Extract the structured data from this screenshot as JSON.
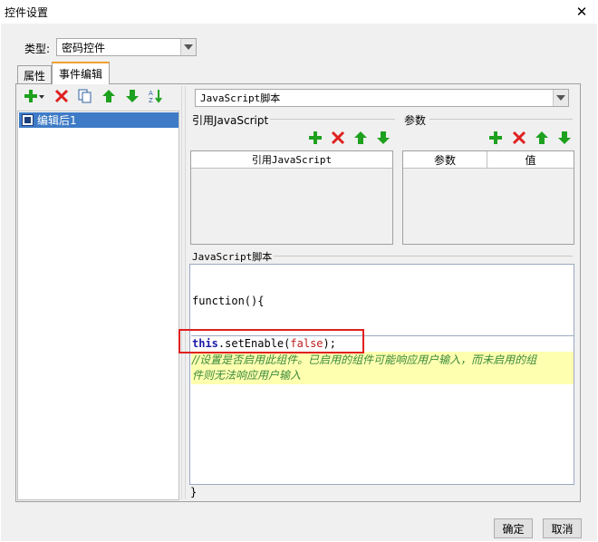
{
  "window": {
    "title": "控件设置"
  },
  "type_field": {
    "label": "类型:",
    "value": "密码控件"
  },
  "tabs": [
    {
      "label": "属性"
    },
    {
      "label": "事件编辑"
    }
  ],
  "event_list": {
    "items": [
      {
        "label": "编辑后1"
      }
    ]
  },
  "script_type": {
    "value": "JavaScript脚本"
  },
  "ref_js": {
    "label": "引用JavaScript",
    "column": "引用JavaScript"
  },
  "params": {
    "label": "参数",
    "col_param": "参数",
    "col_value": "值"
  },
  "js_script": {
    "label": "JavaScript脚本",
    "header": "function(){",
    "code_keyword": "this",
    "code_method": ".setEnable(",
    "code_arg": "false",
    "code_close": ");",
    "comment_line1": "//设置是否启用此组件。已启用的组件可能响应用户输入，而未启用的组",
    "comment_line2": "件则无法响应用户输入",
    "footer": "}"
  },
  "buttons": {
    "ok": "确定",
    "cancel": "取消"
  },
  "icons": {
    "add": "plus-icon",
    "delete": "x-icon",
    "copy": "copy-icon",
    "up": "arrow-up-icon",
    "down": "arrow-down-icon",
    "sort": "sort-az-icon"
  },
  "colors": {
    "green": "#1ea11e",
    "red": "#e02020",
    "selection": "#3e7bc6",
    "tab_accent": "#f0a030"
  }
}
